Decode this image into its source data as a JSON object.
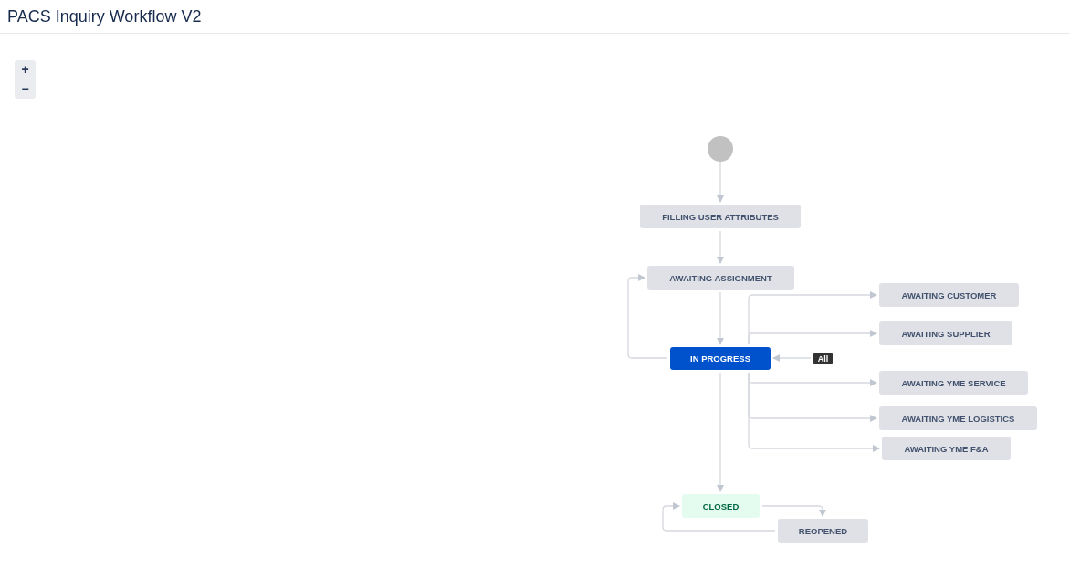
{
  "header": {
    "title": "PACS Inquiry Workflow V2"
  },
  "zoom_controls": [
    {
      "label": "+"
    },
    {
      "label": "−"
    }
  ],
  "nodes": [
    {
      "kind": "start"
    },
    {
      "kind": "todo",
      "label": "FILLING USER ATTRIBUTES"
    },
    {
      "kind": "todo",
      "label": "AWAITING ASSIGNMENT"
    },
    {
      "kind": "inprogress",
      "label": "IN PROGRESS"
    },
    {
      "kind": "todo",
      "label": "AWAITING CUSTOMER"
    },
    {
      "kind": "todo",
      "label": "AWAITING SUPPLIER"
    },
    {
      "kind": "todo",
      "label": "AWAITING YME SERVICE"
    },
    {
      "kind": "todo",
      "label": "AWAITING YME LOGISTICS"
    },
    {
      "kind": "todo",
      "label": "AWAITING YME F&A"
    },
    {
      "kind": "done",
      "label": "CLOSED"
    },
    {
      "kind": "todo",
      "label": "REOPENED"
    },
    {
      "kind": "global",
      "label": "All"
    }
  ]
}
